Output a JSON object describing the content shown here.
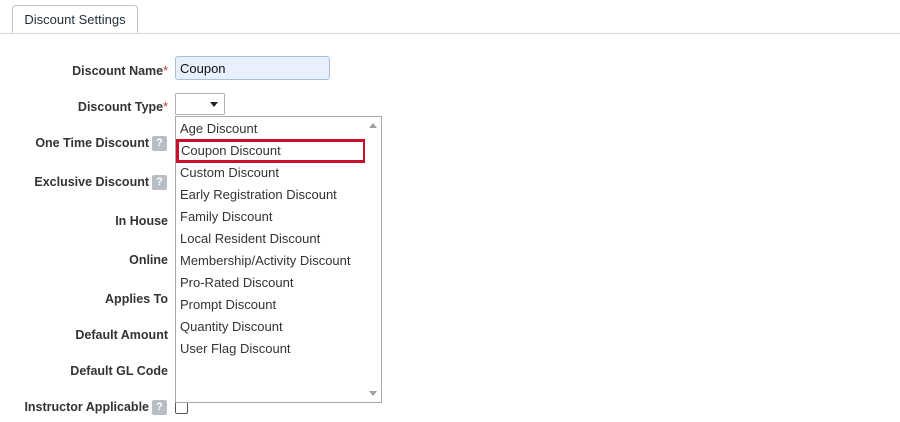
{
  "tab": {
    "label": "Discount Settings"
  },
  "form": {
    "discount_name": {
      "label": "Discount Name",
      "required": "*",
      "value": "Coupon"
    },
    "discount_type": {
      "label": "Discount Type",
      "required": "*"
    },
    "one_time_discount": {
      "label": "One Time Discount",
      "help": "?"
    },
    "exclusive_discount": {
      "label": "Exclusive Discount",
      "help": "?"
    },
    "in_house": {
      "label": "In House"
    },
    "online": {
      "label": "Online"
    },
    "applies_to": {
      "label": "Applies To"
    },
    "default_amount": {
      "label": "Default Amount"
    },
    "default_gl_code": {
      "label": "Default GL Code"
    },
    "instructor_applicable": {
      "label": "Instructor Applicable",
      "help": "?"
    }
  },
  "dropdown": {
    "options": [
      "Age Discount",
      "Coupon Discount",
      "Custom Discount",
      "Early Registration Discount",
      "Family Discount",
      "Local Resident Discount",
      "Membership/Activity Discount",
      "Pro-Rated Discount",
      "Prompt Discount",
      "Quantity Discount",
      "User Flag Discount"
    ],
    "highlighted": "Coupon Discount"
  },
  "colors": {
    "highlight_border": "#c8102e",
    "required_star": "#c0392b"
  }
}
